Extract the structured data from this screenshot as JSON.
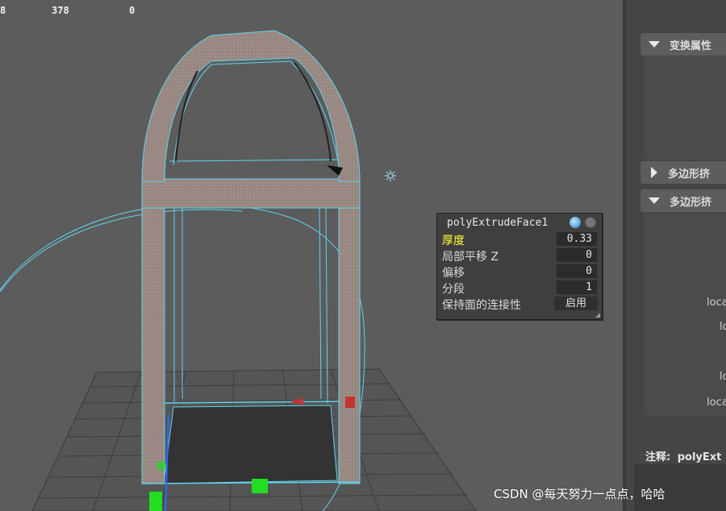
{
  "hud": {
    "col1": "8",
    "col2": "378",
    "col3": "0"
  },
  "popup": {
    "title": "polyExtrudeFace1",
    "rows": [
      {
        "label": "厚度",
        "value": "0.33",
        "highlight": true
      },
      {
        "label": "局部平移 Z",
        "value": "0"
      },
      {
        "label": "偏移",
        "value": "0"
      },
      {
        "label": "分段",
        "value": "1"
      },
      {
        "label": "保持面的连接性",
        "value": "启用"
      }
    ]
  },
  "attribute_editor": {
    "sections": [
      {
        "label": "变换属性",
        "expanded": true
      },
      {
        "label": "多边形挤",
        "expanded": false
      },
      {
        "label": "多边形挤",
        "expanded": true
      }
    ],
    "field_labels": [
      "loca",
      "lo",
      "lo",
      "loca"
    ],
    "note_label": "注释:",
    "note_value": "polyExt"
  },
  "watermark": "CSDN @每天努力一点点，哈哈",
  "colors": {
    "viewport_bg": "#5c5c5c",
    "wireframe": "#5fd3ee",
    "mesh_face": "#9a8a83",
    "highlight_label": "#ffff33",
    "panel_bg": "#454545"
  }
}
